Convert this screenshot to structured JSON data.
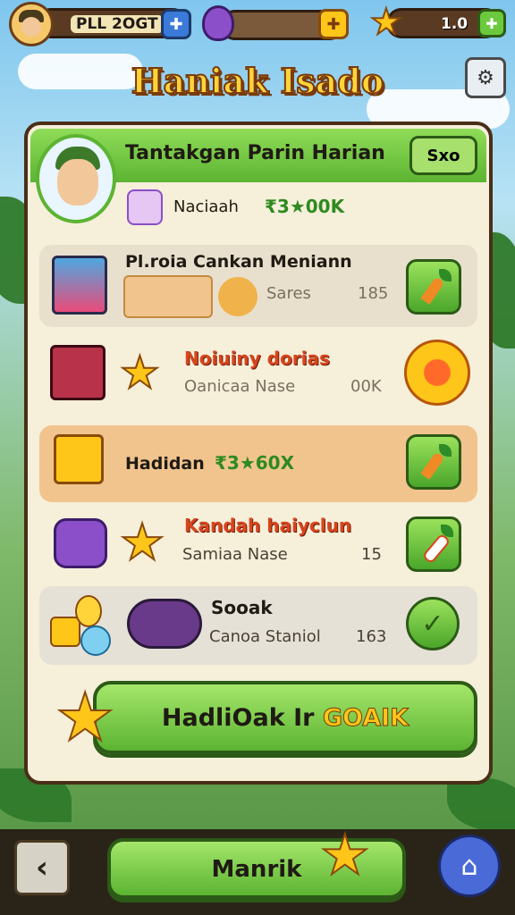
{
  "topbar": {
    "player_name": "PLL 2OGT",
    "gem_icon": "plus-icon",
    "resource_icon": "plus-icon",
    "score": "1.0"
  },
  "screen_title": "Haniak Isado",
  "header_card": {
    "title": "Tantakgan Parin Harian",
    "badge": "Sxo",
    "reward_label": "Naciaah",
    "reward_value": "₹3★00K"
  },
  "rows": [
    {
      "title": "Pl.roia Cankan Meniann",
      "subtitle": "Sares",
      "value": "185",
      "action_icon": "carrot-icon"
    },
    {
      "title": "Noiuiny dorias",
      "subtitle": "Oanicaa Nase",
      "value": "00K",
      "action_icon": "sun-badge-icon"
    },
    {
      "title": "Hadidan",
      "reward_value": "₹3★60X",
      "action_icon": "carrot-icon"
    },
    {
      "title": "Kandah haiyclun",
      "subtitle": "Samiaa Nase",
      "value": "15",
      "action_icon": "radish-icon"
    },
    {
      "title": "Sooak",
      "subtitle": "Canoa Staniol",
      "value": "163",
      "action_icon": "check-icon"
    }
  ],
  "claim_button": {
    "prefix": "HadliOak Ir ",
    "highlight": "GOAIK"
  },
  "bottom_nav": {
    "main_label": "Manrik"
  },
  "colors": {
    "accent_green": "#5cb432",
    "title_yellow": "#ffd43b",
    "panel_bg": "#f6efd9",
    "highlight_row": "#f1c48e"
  }
}
